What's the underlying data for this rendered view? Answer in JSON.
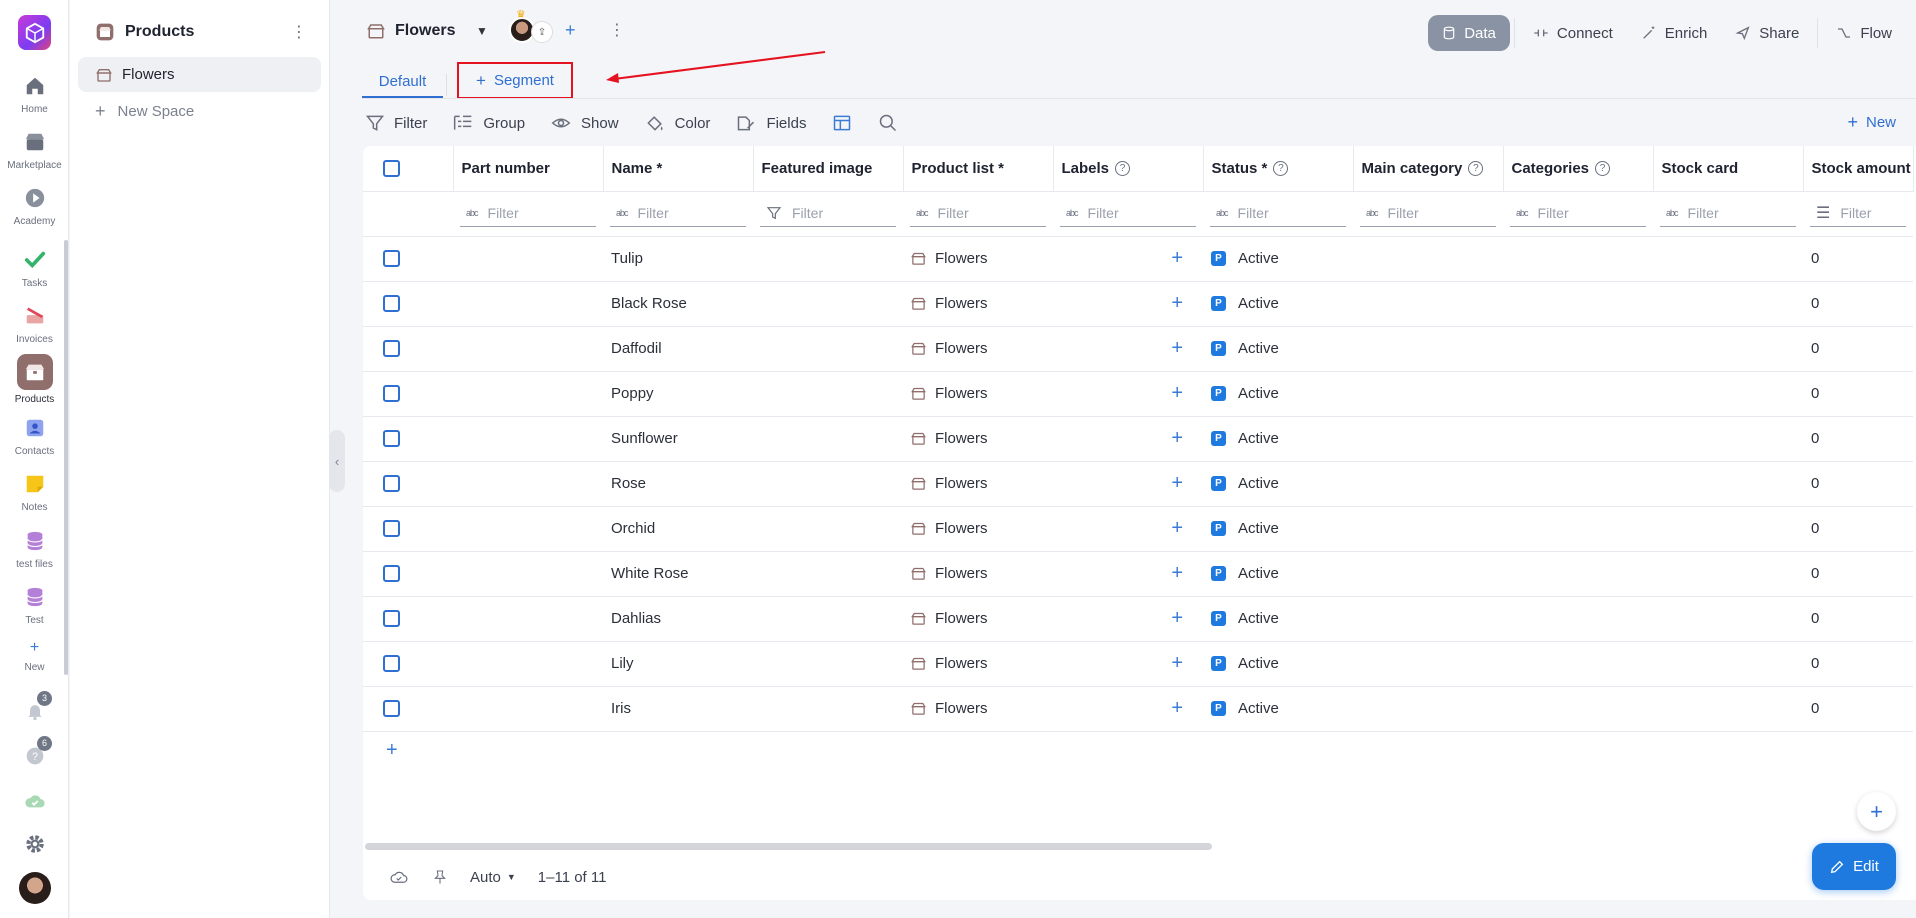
{
  "rail": {
    "items": [
      {
        "label": "Home",
        "icon": "home-icon"
      },
      {
        "label": "Marketplace",
        "icon": "marketplace-icon"
      },
      {
        "label": "Academy",
        "icon": "academy-icon"
      },
      {
        "label": "Tasks",
        "icon": "tasks-icon"
      },
      {
        "label": "Invoices",
        "icon": "invoices-icon"
      },
      {
        "label": "Products",
        "icon": "products-icon"
      },
      {
        "label": "Contacts",
        "icon": "contacts-icon"
      },
      {
        "label": "Notes",
        "icon": "notes-icon"
      },
      {
        "label": "test files",
        "icon": "database-icon"
      },
      {
        "label": "Test",
        "icon": "database-icon"
      },
      {
        "label": "New",
        "icon": "plus-icon"
      }
    ],
    "notifications_badge": "3",
    "help_badge": "6"
  },
  "sidebar": {
    "title": "Products",
    "items": [
      {
        "label": "Flowers"
      }
    ],
    "new_space": "New Space"
  },
  "topbar": {
    "title": "Flowers",
    "buttons": [
      "Data",
      "Connect",
      "Enrich",
      "Share",
      "Flow"
    ]
  },
  "tabs": {
    "default": "Default",
    "segment": "Segment"
  },
  "toolbar": {
    "filter": "Filter",
    "group": "Group",
    "show": "Show",
    "color": "Color",
    "fields": "Fields",
    "new": "New"
  },
  "table": {
    "columns": [
      "Part number",
      "Name *",
      "Featured image",
      "Product list *",
      "Labels",
      "Status *",
      "Main category",
      "Categories",
      "Stock card",
      "Stock amount"
    ],
    "filter_placeholder": "Filter",
    "rows": [
      {
        "name": "Tulip",
        "product_list": "Flowers",
        "status": "Active",
        "stock_amount": "0"
      },
      {
        "name": "Black Rose",
        "product_list": "Flowers",
        "status": "Active",
        "stock_amount": "0"
      },
      {
        "name": "Daffodil",
        "product_list": "Flowers",
        "status": "Active",
        "stock_amount": "0"
      },
      {
        "name": "Poppy",
        "product_list": "Flowers",
        "status": "Active",
        "stock_amount": "0"
      },
      {
        "name": "Sunflower",
        "product_list": "Flowers",
        "status": "Active",
        "stock_amount": "0"
      },
      {
        "name": "Rose",
        "product_list": "Flowers",
        "status": "Active",
        "stock_amount": "0"
      },
      {
        "name": "Orchid",
        "product_list": "Flowers",
        "status": "Active",
        "stock_amount": "0"
      },
      {
        "name": "White Rose",
        "product_list": "Flowers",
        "status": "Active",
        "stock_amount": "0"
      },
      {
        "name": "Dahlias",
        "product_list": "Flowers",
        "status": "Active",
        "stock_amount": "0"
      },
      {
        "name": "Lily",
        "product_list": "Flowers",
        "status": "Active",
        "stock_amount": "0"
      },
      {
        "name": "Iris",
        "product_list": "Flowers",
        "status": "Active",
        "stock_amount": "0"
      }
    ]
  },
  "footer": {
    "row_height": "Auto",
    "pagination": "1–11 of 11"
  },
  "edit_button": "Edit",
  "colors": {
    "accent": "#2f6fd1",
    "highlight_box": "#e5121f",
    "status_badge": "#1f7ae0"
  }
}
